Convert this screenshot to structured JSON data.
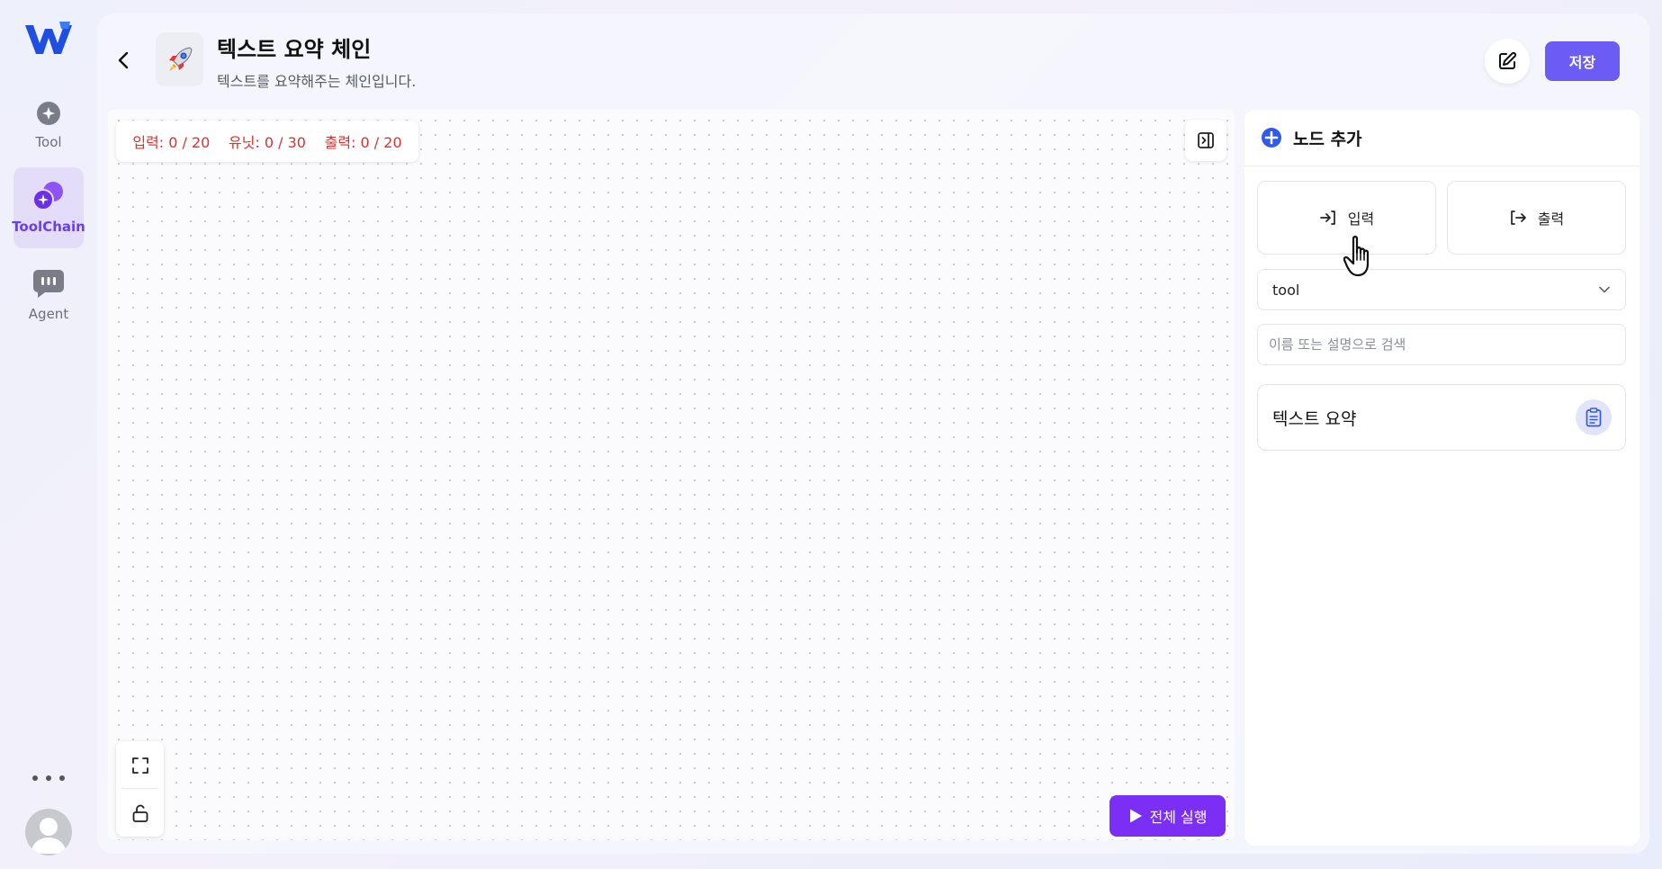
{
  "sidebar": {
    "items": [
      {
        "label": "Tool",
        "icon": "sparkle-circle-icon"
      },
      {
        "label": "ToolChain",
        "icon": "linked-circles-icon",
        "active": true
      },
      {
        "label": "Agent",
        "icon": "chat-bubble-icon"
      }
    ],
    "accent_color": "#6b3df0"
  },
  "header": {
    "title": "텍스트 요약 체인",
    "subtitle": "텍스트를 요약해주는 체인입니다.",
    "icon": "rocket-icon",
    "save_label": "저장"
  },
  "canvas": {
    "counts": {
      "input": "입력: 0 / 20",
      "unit": "유닛: 0 / 30",
      "output": "출력: 0 / 20"
    },
    "run_all_label": "전체 실행",
    "run_color": "#7b2ff5"
  },
  "node_panel": {
    "title": "노드 추가",
    "input_label": "입력",
    "output_label": "출력",
    "filter_value": "tool",
    "search_placeholder": "이름 또는 설명으로 검색",
    "tools": [
      {
        "name": "텍스트 요약",
        "icon": "clipboard-icon"
      }
    ]
  }
}
